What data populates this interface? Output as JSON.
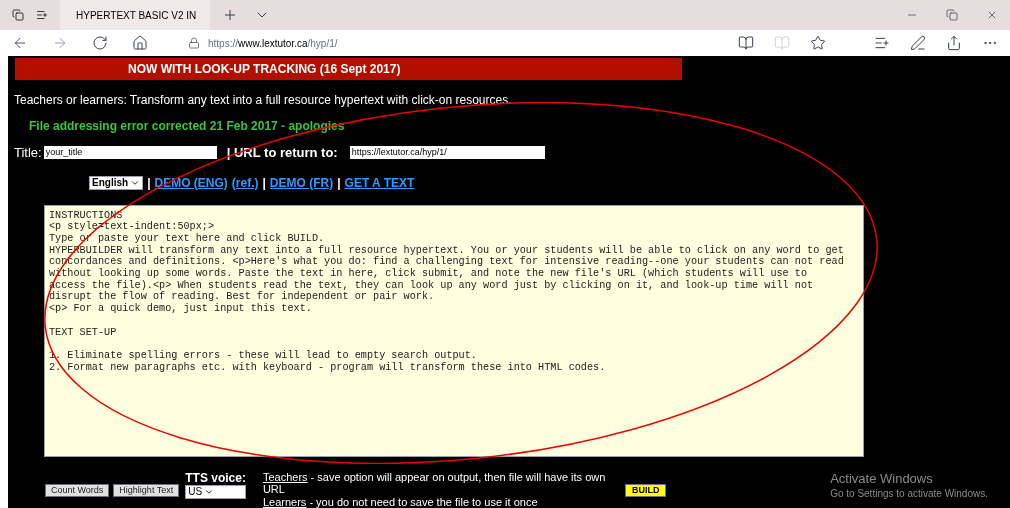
{
  "browser": {
    "tab_title": "HYPERTEXT BASIC V2 IN",
    "address": {
      "scheme": "https://",
      "host": "www.lextutor.ca",
      "path": "/hyp/1/"
    }
  },
  "banner": "NOW WITH LOOK-UP TRACKING (16 Sept 2017)",
  "intro": "Teachers or learners: Transform any text into a full resource hypertext with click-on resources.",
  "notice": "File addressing error corrected 21 Feb 2017 - apologies",
  "title_field": {
    "label": "Title:",
    "value": "your_title"
  },
  "url_field": {
    "label": "| URL to return to:",
    "value": "https://lextutor.ca/hyp/1/"
  },
  "language_select": "English",
  "links": [
    {
      "kind": "sep",
      "text": "|"
    },
    {
      "kind": "link",
      "text": "DEMO (ENG)"
    },
    {
      "kind": "link",
      "text": "(ref.)"
    },
    {
      "kind": "sep",
      "text": "|"
    },
    {
      "kind": "link",
      "text": "DEMO (FR)"
    },
    {
      "kind": "sep",
      "text": "|"
    },
    {
      "kind": "link",
      "text": "GET A TEXT"
    }
  ],
  "text_area": "INSTRUCTIONS\n<p style=text-indent:50px;>\nType or paste your text here and click BUILD.\nHYPERBUILDER will transform any text into a full resource hypertext. You or your students will be able to click on any word to get\nconcordances and definitions. <p>Here's what you do: find a challenging text for intensive reading--one your students can not read\nwithout looking up some words. Paste the text in here, click submit, and note the new file's URL (which students will use to\naccess the file).<p> When students read the text, they can look up any word just by clicking on it, and look-up time will not\ndisrupt the flow of reading. Best for independent or pair work.\n<p> For a quick demo, just input this text.\n\nTEXT SET-UP\n\n1. Eliminate spelling errors - these will lead to empty search output.\n2. Format new paragraphs etc. with keyboard - program will transform these into HTML codes.",
  "buttons": [
    "Count Words",
    "Highlight Text"
  ],
  "tts": {
    "label": "TTS voice:",
    "value": "US"
  },
  "notes": [
    {
      "link": "Teachers",
      "text": " - save option will appear on output, then file will have its own URL"
    },
    {
      "link": "Learners",
      "text": " - you do not need to save the file to use it once"
    }
  ],
  "build_button": "BUILD",
  "watermark": {
    "title": "Activate Windows",
    "subtitle": "Go to Settings to activate Windows."
  }
}
